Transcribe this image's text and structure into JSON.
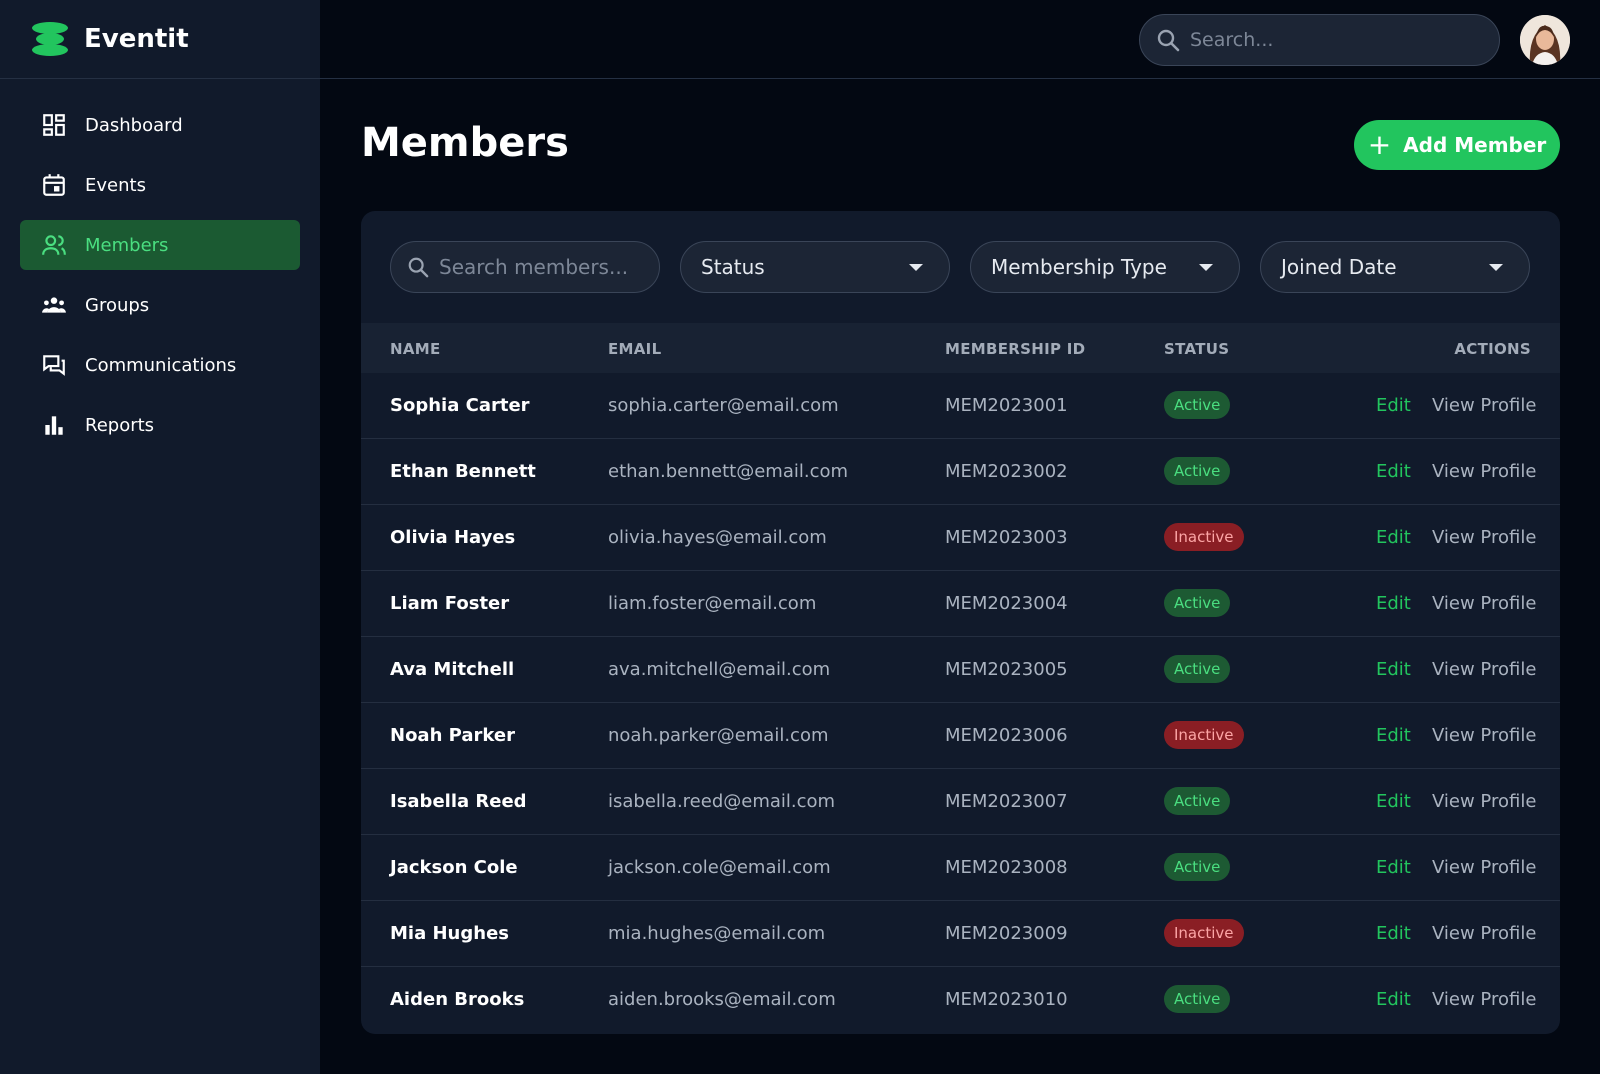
{
  "app": {
    "name": "Eventit"
  },
  "sidebar": {
    "items": [
      {
        "label": "Dashboard",
        "icon": "dashboard-icon",
        "active": false
      },
      {
        "label": "Events",
        "icon": "calendar-icon",
        "active": false
      },
      {
        "label": "Members",
        "icon": "members-icon",
        "active": true
      },
      {
        "label": "Groups",
        "icon": "groups-icon",
        "active": false
      },
      {
        "label": "Communications",
        "icon": "chat-icon",
        "active": false
      },
      {
        "label": "Reports",
        "icon": "bar-chart-icon",
        "active": false
      }
    ]
  },
  "topbar": {
    "search_placeholder": "Search..."
  },
  "page": {
    "title": "Members",
    "add_button": "Add Member"
  },
  "filters": {
    "search_placeholder": "Search members...",
    "status": "Status",
    "membership_type": "Membership Type",
    "joined_date": "Joined Date"
  },
  "table": {
    "headers": {
      "name": "NAME",
      "email": "EMAIL",
      "id": "MEMBERSHIP ID",
      "status": "STATUS",
      "actions": "ACTIONS"
    },
    "edit_label": "Edit",
    "view_label": "View Profile",
    "rows": [
      {
        "name": "Sophia Carter",
        "email": "sophia.carter@email.com",
        "id": "MEM2023001",
        "status": "Active"
      },
      {
        "name": "Ethan Bennett",
        "email": "ethan.bennett@email.com",
        "id": "MEM2023002",
        "status": "Active"
      },
      {
        "name": "Olivia Hayes",
        "email": "olivia.hayes@email.com",
        "id": "MEM2023003",
        "status": "Inactive"
      },
      {
        "name": "Liam Foster",
        "email": "liam.foster@email.com",
        "id": "MEM2023004",
        "status": "Active"
      },
      {
        "name": "Ava Mitchell",
        "email": "ava.mitchell@email.com",
        "id": "MEM2023005",
        "status": "Active"
      },
      {
        "name": "Noah Parker",
        "email": "noah.parker@email.com",
        "id": "MEM2023006",
        "status": "Inactive"
      },
      {
        "name": "Isabella Reed",
        "email": "isabella.reed@email.com",
        "id": "MEM2023007",
        "status": "Active"
      },
      {
        "name": "Jackson Cole",
        "email": "jackson.cole@email.com",
        "id": "MEM2023008",
        "status": "Active"
      },
      {
        "name": "Mia Hughes",
        "email": "mia.hughes@email.com",
        "id": "MEM2023009",
        "status": "Inactive"
      },
      {
        "name": "Aiden Brooks",
        "email": "aiden.brooks@email.com",
        "id": "MEM2023010",
        "status": "Active"
      }
    ]
  },
  "colors": {
    "accent": "#22c55e",
    "active_bg": "#1b5a32",
    "inactive_bg": "#8a1e24"
  }
}
